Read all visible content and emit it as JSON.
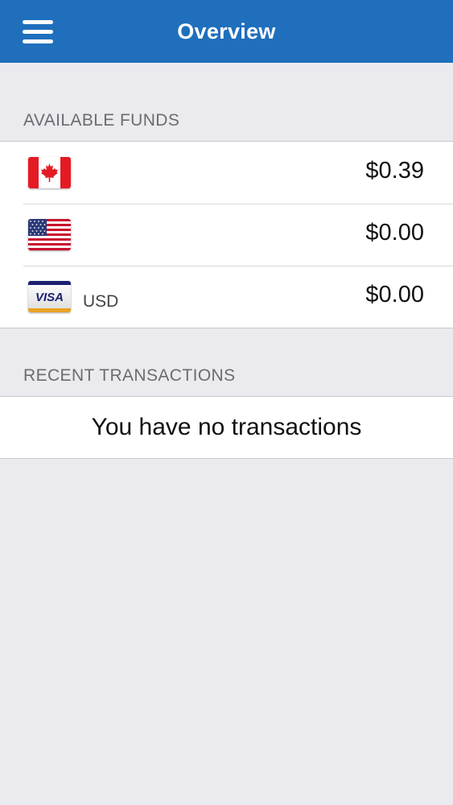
{
  "header": {
    "title": "Overview",
    "menu_icon": "hamburger-menu-icon"
  },
  "funds": {
    "section_label": "AVAILABLE FUNDS",
    "rows": [
      {
        "icon": "canada-flag-icon",
        "label": "",
        "amount": "$0.39"
      },
      {
        "icon": "usa-flag-icon",
        "label": "",
        "amount": "$0.00"
      },
      {
        "icon": "visa-card-icon",
        "label": "USD",
        "amount": "$0.00"
      }
    ]
  },
  "transactions": {
    "section_label": "RECENT TRANSACTIONS",
    "empty_message": "You have no transactions"
  },
  "colors": {
    "header_bg": "#1f6fbd",
    "page_bg": "#ebebef"
  }
}
